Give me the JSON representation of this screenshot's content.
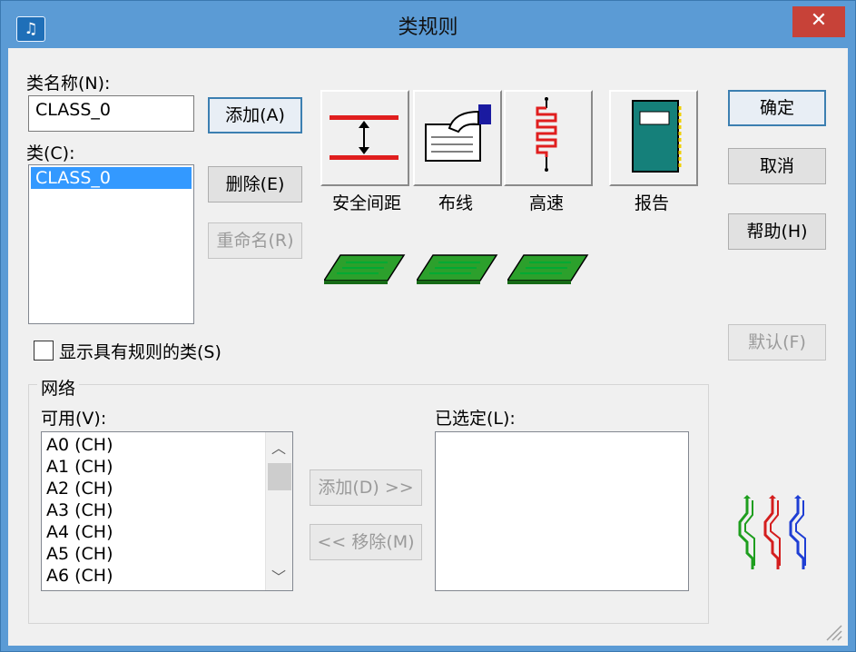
{
  "window": {
    "title": "类规则",
    "close_glyph": "✕",
    "app_icon_glyph": "♫"
  },
  "class_name": {
    "label": "类名称(N):",
    "value": "CLASS_0"
  },
  "classes": {
    "label": "类(C):",
    "items": [
      "CLASS_0"
    ]
  },
  "class_buttons": {
    "add": "添加(A)",
    "delete": "删除(E)",
    "rename": "重命名(R)"
  },
  "rule_buttons": {
    "clearance": "安全间距",
    "routing": "布线",
    "high_speed": "高速",
    "report": "报告"
  },
  "dialog_buttons": {
    "ok": "确定",
    "cancel": "取消",
    "help": "帮助(H)",
    "default": "默认(F)"
  },
  "show_rules_checkbox": {
    "label": "显示具有规则的类(S)",
    "checked": false
  },
  "nets": {
    "group_label": "网络",
    "available_label": "可用(V):",
    "selected_label": "已选定(L):",
    "available_items": [
      "A0  (CH)",
      "A1  (CH)",
      "A2  (CH)",
      "A3  (CH)",
      "A4  (CH)",
      "A5  (CH)",
      "A6  (CH)"
    ],
    "selected_items": [],
    "add_button": "添加(D) >>",
    "remove_button": "<< 移除(M)",
    "scroll_up_glyph": "︿",
    "scroll_down_glyph": "﹀"
  },
  "colors": {
    "titlebar": "#5b9bd5",
    "selection": "#3399ff",
    "close": "#c74238"
  }
}
